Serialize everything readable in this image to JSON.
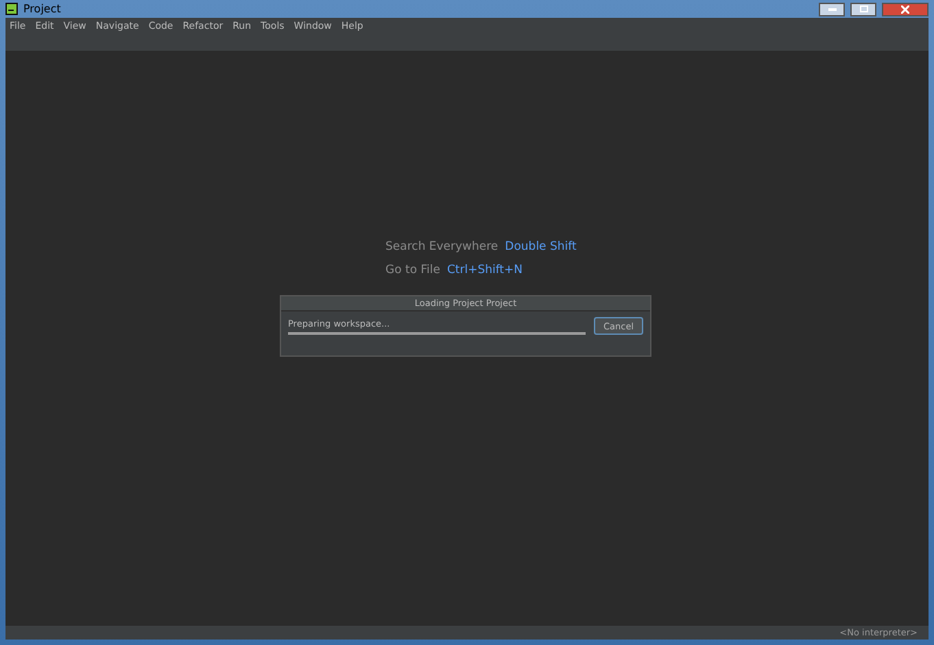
{
  "window": {
    "title": "Project"
  },
  "menu": [
    "File",
    "Edit",
    "View",
    "Navigate",
    "Code",
    "Refactor",
    "Run",
    "Tools",
    "Window",
    "Help"
  ],
  "hints": [
    {
      "label": "Search Everywhere",
      "shortcut": "Double Shift"
    },
    {
      "label": "Go to File",
      "shortcut": "Ctrl+Shift+N"
    }
  ],
  "dialog": {
    "title": "Loading Project Project",
    "message": "Preparing workspace...",
    "level": 1,
    "button": "Cancel"
  },
  "status_bar": {
    "interpreter": "<No interpreter>"
  }
}
